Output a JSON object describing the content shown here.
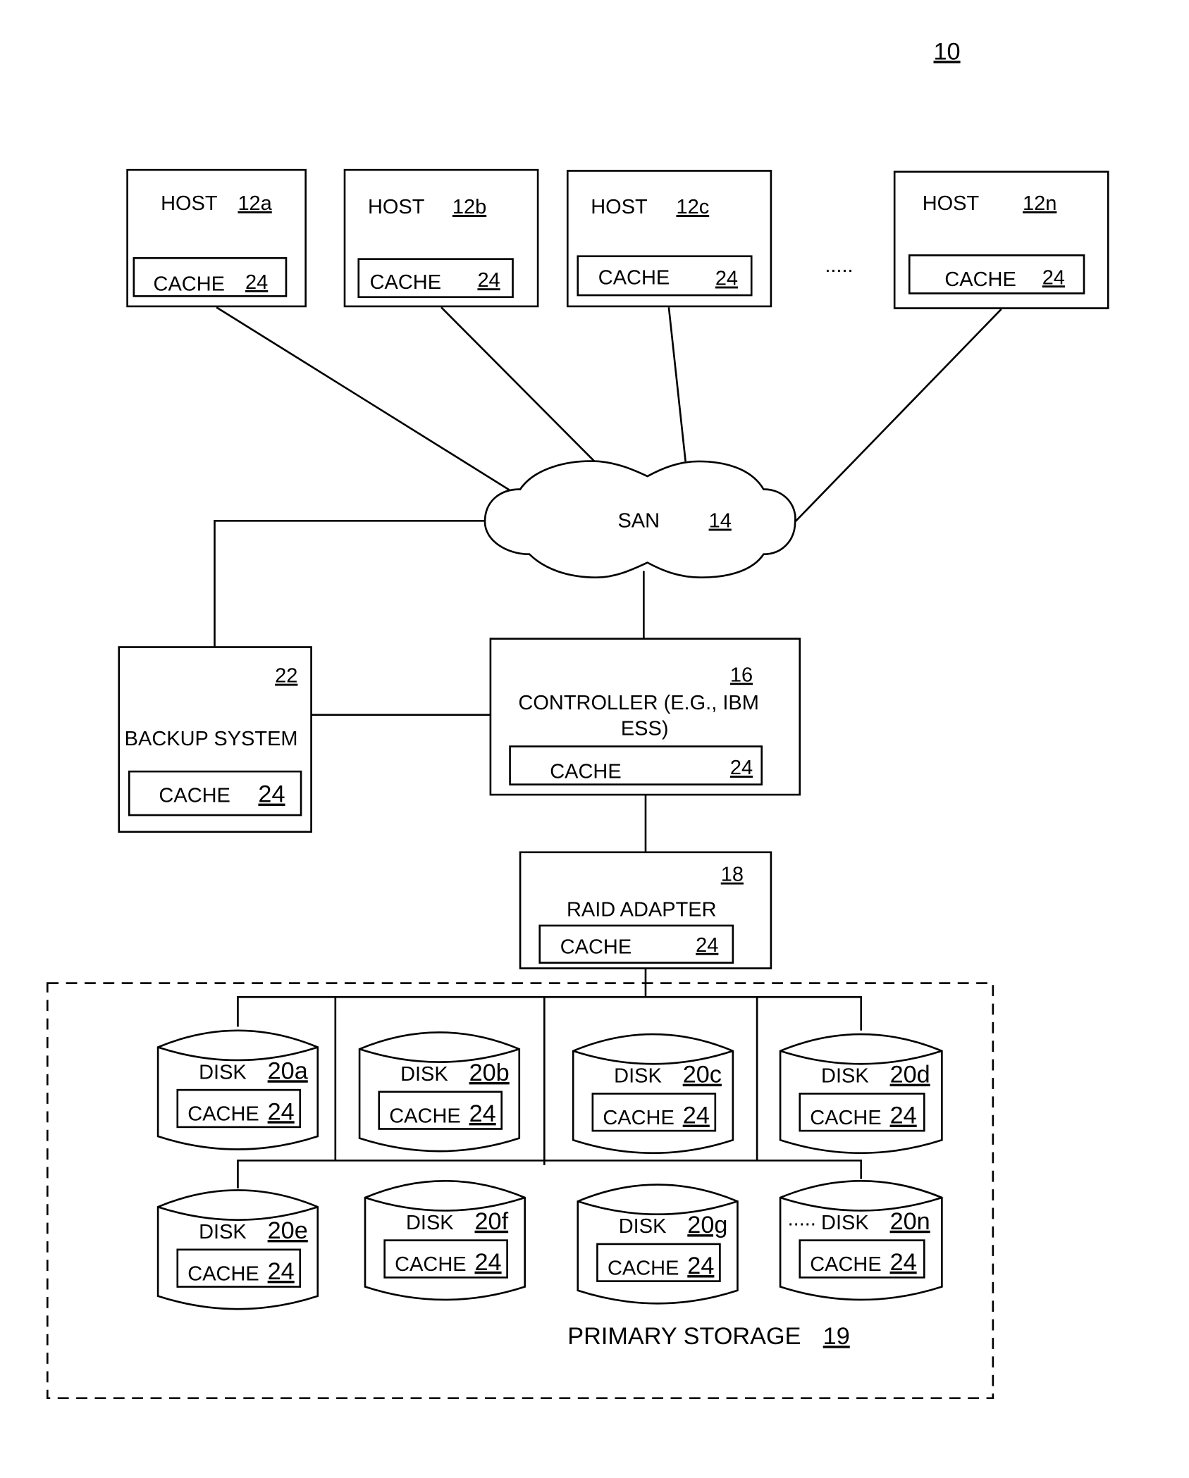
{
  "figure_ref": "10",
  "hosts": [
    {
      "label": "HOST",
      "ref": "12a",
      "cache_label": "CACHE",
      "cache_ref": "24"
    },
    {
      "label": "HOST",
      "ref": "12b",
      "cache_label": "CACHE",
      "cache_ref": "24"
    },
    {
      "label": "HOST",
      "ref": "12c",
      "cache_label": "CACHE",
      "cache_ref": "24"
    },
    {
      "label": "HOST",
      "ref": "12n",
      "cache_label": "CACHE",
      "cache_ref": "24"
    }
  ],
  "host_ellipsis": ".....",
  "san": {
    "label": "SAN",
    "ref": "14"
  },
  "backup": {
    "label": "BACKUP SYSTEM",
    "ref": "22",
    "cache_label": "CACHE",
    "cache_ref": "24"
  },
  "controller": {
    "label_line1": "CONTROLLER (E.G., IBM",
    "label_line2": "ESS)",
    "ref": "16",
    "cache_label": "CACHE",
    "cache_ref": "24"
  },
  "raid": {
    "label": "RAID ADAPTER",
    "ref": "18",
    "cache_label": "CACHE",
    "cache_ref": "24"
  },
  "disks": [
    {
      "label": "DISK",
      "ref": "20a",
      "cache_label": "CACHE",
      "cache_ref": "24"
    },
    {
      "label": "DISK",
      "ref": "20b",
      "cache_label": "CACHE",
      "cache_ref": "24"
    },
    {
      "label": "DISK",
      "ref": "20c",
      "cache_label": "CACHE",
      "cache_ref": "24"
    },
    {
      "label": "DISK",
      "ref": "20d",
      "cache_label": "CACHE",
      "cache_ref": "24"
    },
    {
      "label": "DISK",
      "ref": "20e",
      "cache_label": "CACHE",
      "cache_ref": "24"
    },
    {
      "label": "DISK",
      "ref": "20f",
      "cache_label": "CACHE",
      "cache_ref": "24"
    },
    {
      "label": "DISK",
      "ref": "20g",
      "cache_label": "CACHE",
      "cache_ref": "24"
    },
    {
      "label": "DISK",
      "ref": "20n",
      "cache_label": "CACHE",
      "cache_ref": "24"
    }
  ],
  "disk_ellipsis": ".....",
  "primary_storage": {
    "label": "PRIMARY STORAGE",
    "ref": "19"
  }
}
